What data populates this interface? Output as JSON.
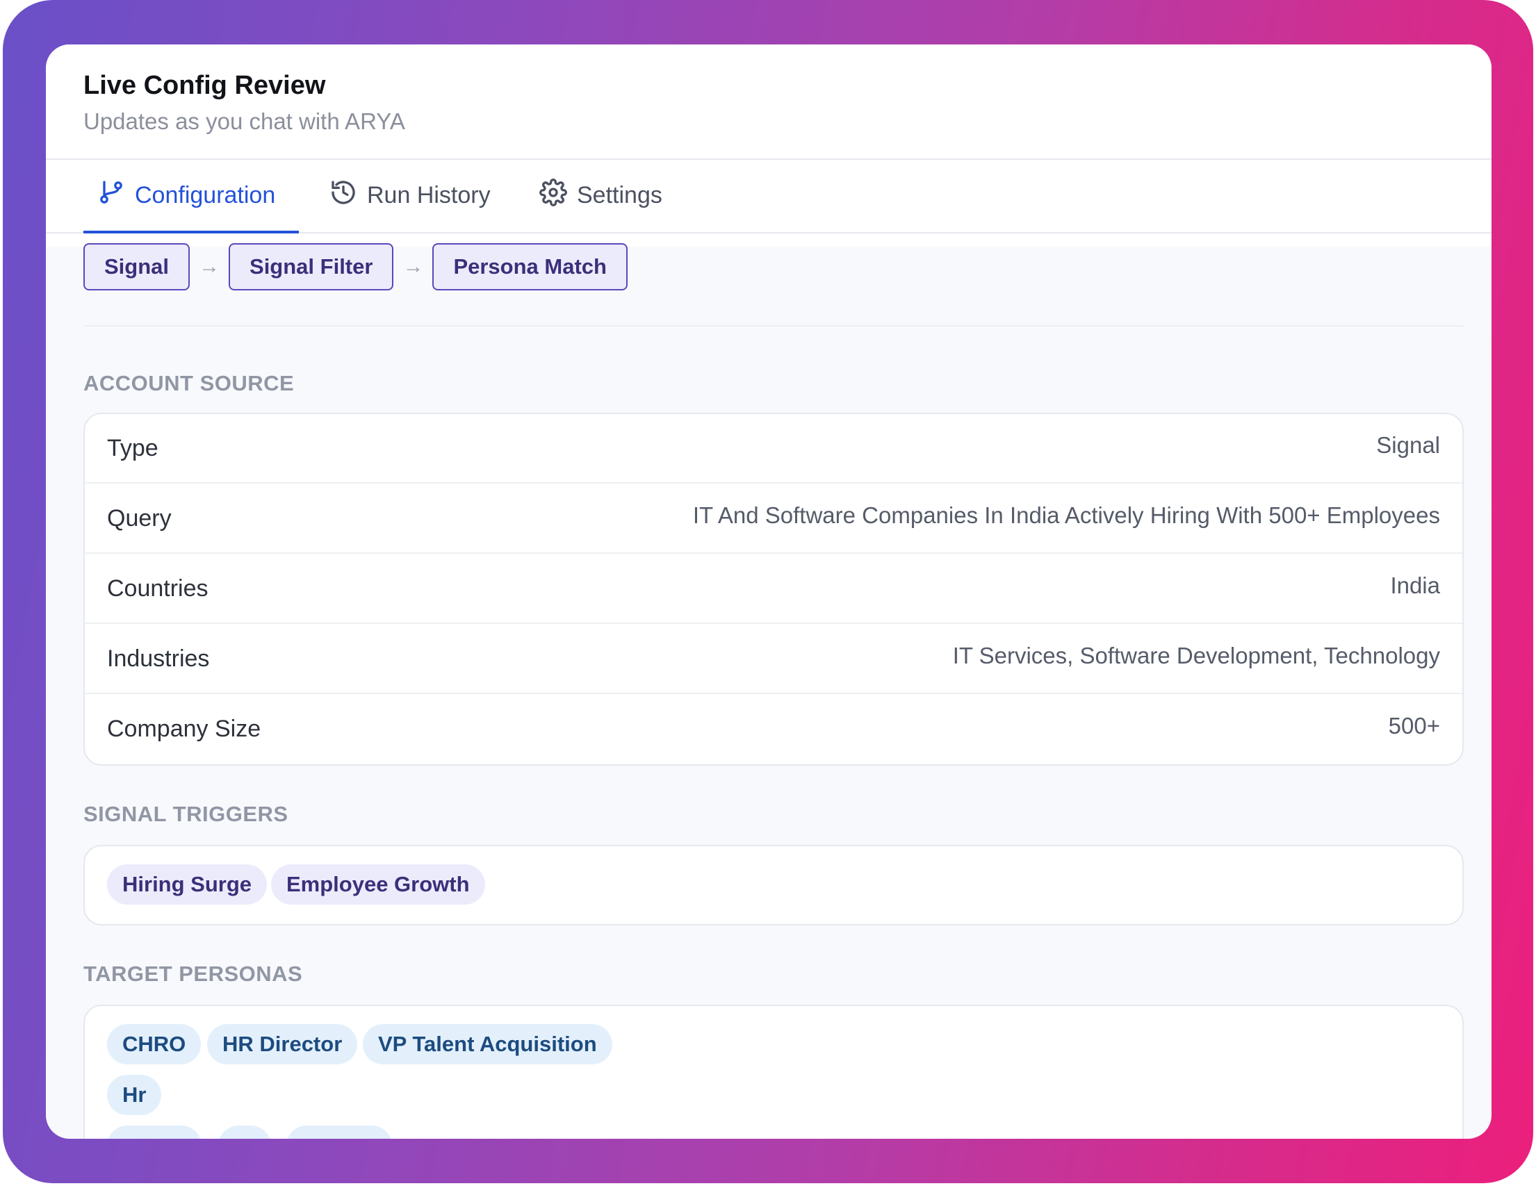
{
  "header": {
    "title": "Live Config Review",
    "subtitle": "Updates as you chat with ARYA"
  },
  "tabs": [
    {
      "label": "Configuration",
      "icon": "git-branch-icon",
      "active": true
    },
    {
      "label": "Run History",
      "icon": "history-icon",
      "active": false
    },
    {
      "label": "Settings",
      "icon": "gear-icon",
      "active": false
    }
  ],
  "pipeline": {
    "steps": [
      "Signal",
      "Signal Filter",
      "Persona Match"
    ],
    "separator": "→"
  },
  "account_source": {
    "label": "ACCOUNT SOURCE",
    "rows": [
      {
        "key": "Type",
        "value": "Signal"
      },
      {
        "key": "Query",
        "value": "IT And Software Companies In India Actively Hiring With 500+ Employees"
      },
      {
        "key": "Countries",
        "value": "India"
      },
      {
        "key": "Industries",
        "value": "IT Services, Software Development, Technology"
      },
      {
        "key": "Company Size",
        "value": "500+"
      }
    ]
  },
  "signal_triggers": {
    "label": "SIGNAL TRIGGERS",
    "items": [
      "Hiring Surge",
      "Employee Growth"
    ]
  },
  "target_personas": {
    "label": "TARGET PERSONAS",
    "items": [
      "CHRO",
      "HR Director",
      "VP Talent Acquisition",
      "Hr"
    ]
  },
  "colors": {
    "accent": "#2352d8",
    "gradient_start": "#6a50c8",
    "gradient_end": "#ec1f7c"
  }
}
